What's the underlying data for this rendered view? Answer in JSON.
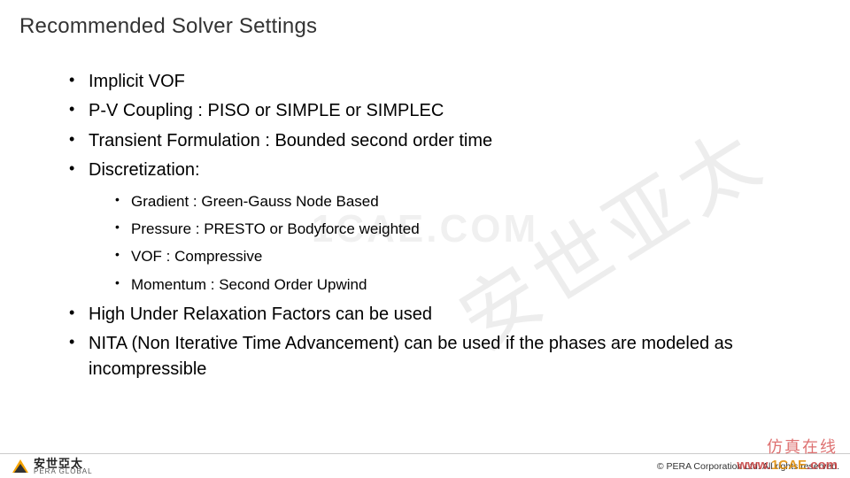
{
  "title": "Recommended Solver Settings",
  "bullets": {
    "b0": "Implicit VOF",
    "b1": "P-V Coupling : PISO or SIMPLE or SIMPLEC",
    "b2": "Transient Formulation : Bounded second order time",
    "b3": "Discretization:",
    "b4": "High Under Relaxation Factors can be used",
    "b5": "NITA (Non Iterative Time Advancement) can be used if the phases are modeled as incompressible"
  },
  "sub": {
    "s0": "Gradient : Green-Gauss Node Based",
    "s1": "Pressure : PRESTO or Bodyforce weighted",
    "s2": "VOF : Compressive",
    "s3": "Momentum : Second Order Upwind"
  },
  "watermarks": {
    "diag": "安世亚太",
    "center": "1CAE.COM",
    "site_cn": "仿真在线",
    "site_url_pre": "www.",
    "site_url_mid": "1CAE",
    "site_url_post": ".com"
  },
  "footer": {
    "logo_cn": "安世亞太",
    "logo_en": "PERA GLOBAL",
    "copyright": "©   PERA Corporation Ltd. All rights reserved."
  }
}
